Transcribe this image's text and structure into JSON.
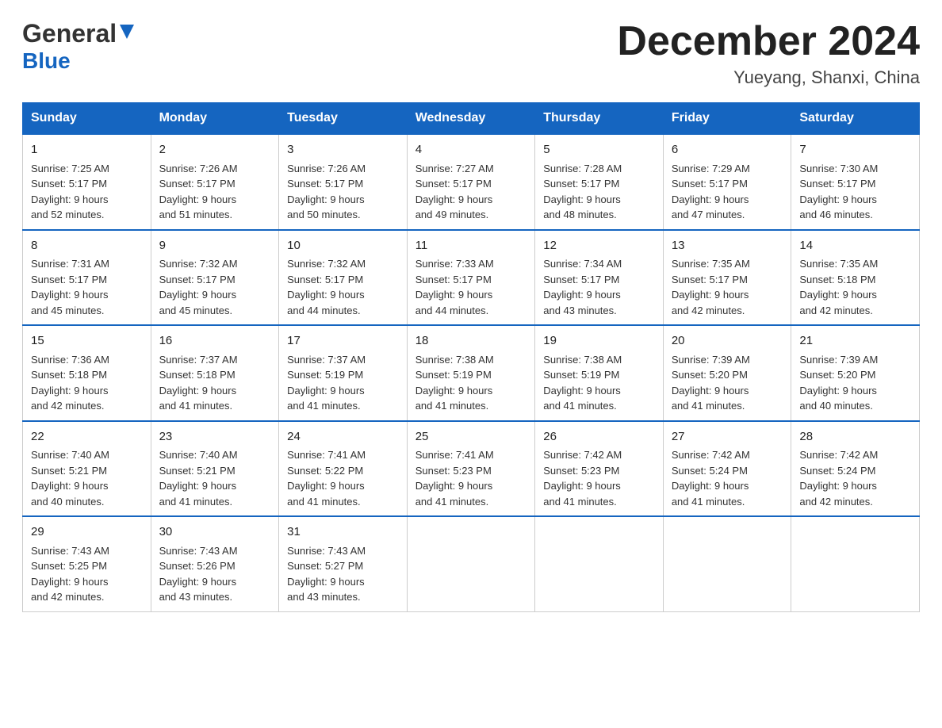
{
  "header": {
    "logo_line1": "General",
    "logo_line2": "Blue",
    "calendar_title": "December 2024",
    "calendar_subtitle": "Yueyang, Shanxi, China"
  },
  "weekdays": [
    "Sunday",
    "Monday",
    "Tuesday",
    "Wednesday",
    "Thursday",
    "Friday",
    "Saturday"
  ],
  "weeks": [
    [
      {
        "day": "1",
        "info": "Sunrise: 7:25 AM\nSunset: 5:17 PM\nDaylight: 9 hours\nand 52 minutes."
      },
      {
        "day": "2",
        "info": "Sunrise: 7:26 AM\nSunset: 5:17 PM\nDaylight: 9 hours\nand 51 minutes."
      },
      {
        "day": "3",
        "info": "Sunrise: 7:26 AM\nSunset: 5:17 PM\nDaylight: 9 hours\nand 50 minutes."
      },
      {
        "day": "4",
        "info": "Sunrise: 7:27 AM\nSunset: 5:17 PM\nDaylight: 9 hours\nand 49 minutes."
      },
      {
        "day": "5",
        "info": "Sunrise: 7:28 AM\nSunset: 5:17 PM\nDaylight: 9 hours\nand 48 minutes."
      },
      {
        "day": "6",
        "info": "Sunrise: 7:29 AM\nSunset: 5:17 PM\nDaylight: 9 hours\nand 47 minutes."
      },
      {
        "day": "7",
        "info": "Sunrise: 7:30 AM\nSunset: 5:17 PM\nDaylight: 9 hours\nand 46 minutes."
      }
    ],
    [
      {
        "day": "8",
        "info": "Sunrise: 7:31 AM\nSunset: 5:17 PM\nDaylight: 9 hours\nand 45 minutes."
      },
      {
        "day": "9",
        "info": "Sunrise: 7:32 AM\nSunset: 5:17 PM\nDaylight: 9 hours\nand 45 minutes."
      },
      {
        "day": "10",
        "info": "Sunrise: 7:32 AM\nSunset: 5:17 PM\nDaylight: 9 hours\nand 44 minutes."
      },
      {
        "day": "11",
        "info": "Sunrise: 7:33 AM\nSunset: 5:17 PM\nDaylight: 9 hours\nand 44 minutes."
      },
      {
        "day": "12",
        "info": "Sunrise: 7:34 AM\nSunset: 5:17 PM\nDaylight: 9 hours\nand 43 minutes."
      },
      {
        "day": "13",
        "info": "Sunrise: 7:35 AM\nSunset: 5:17 PM\nDaylight: 9 hours\nand 42 minutes."
      },
      {
        "day": "14",
        "info": "Sunrise: 7:35 AM\nSunset: 5:18 PM\nDaylight: 9 hours\nand 42 minutes."
      }
    ],
    [
      {
        "day": "15",
        "info": "Sunrise: 7:36 AM\nSunset: 5:18 PM\nDaylight: 9 hours\nand 42 minutes."
      },
      {
        "day": "16",
        "info": "Sunrise: 7:37 AM\nSunset: 5:18 PM\nDaylight: 9 hours\nand 41 minutes."
      },
      {
        "day": "17",
        "info": "Sunrise: 7:37 AM\nSunset: 5:19 PM\nDaylight: 9 hours\nand 41 minutes."
      },
      {
        "day": "18",
        "info": "Sunrise: 7:38 AM\nSunset: 5:19 PM\nDaylight: 9 hours\nand 41 minutes."
      },
      {
        "day": "19",
        "info": "Sunrise: 7:38 AM\nSunset: 5:19 PM\nDaylight: 9 hours\nand 41 minutes."
      },
      {
        "day": "20",
        "info": "Sunrise: 7:39 AM\nSunset: 5:20 PM\nDaylight: 9 hours\nand 41 minutes."
      },
      {
        "day": "21",
        "info": "Sunrise: 7:39 AM\nSunset: 5:20 PM\nDaylight: 9 hours\nand 40 minutes."
      }
    ],
    [
      {
        "day": "22",
        "info": "Sunrise: 7:40 AM\nSunset: 5:21 PM\nDaylight: 9 hours\nand 40 minutes."
      },
      {
        "day": "23",
        "info": "Sunrise: 7:40 AM\nSunset: 5:21 PM\nDaylight: 9 hours\nand 41 minutes."
      },
      {
        "day": "24",
        "info": "Sunrise: 7:41 AM\nSunset: 5:22 PM\nDaylight: 9 hours\nand 41 minutes."
      },
      {
        "day": "25",
        "info": "Sunrise: 7:41 AM\nSunset: 5:23 PM\nDaylight: 9 hours\nand 41 minutes."
      },
      {
        "day": "26",
        "info": "Sunrise: 7:42 AM\nSunset: 5:23 PM\nDaylight: 9 hours\nand 41 minutes."
      },
      {
        "day": "27",
        "info": "Sunrise: 7:42 AM\nSunset: 5:24 PM\nDaylight: 9 hours\nand 41 minutes."
      },
      {
        "day": "28",
        "info": "Sunrise: 7:42 AM\nSunset: 5:24 PM\nDaylight: 9 hours\nand 42 minutes."
      }
    ],
    [
      {
        "day": "29",
        "info": "Sunrise: 7:43 AM\nSunset: 5:25 PM\nDaylight: 9 hours\nand 42 minutes."
      },
      {
        "day": "30",
        "info": "Sunrise: 7:43 AM\nSunset: 5:26 PM\nDaylight: 9 hours\nand 43 minutes."
      },
      {
        "day": "31",
        "info": "Sunrise: 7:43 AM\nSunset: 5:27 PM\nDaylight: 9 hours\nand 43 minutes."
      },
      {
        "day": "",
        "info": ""
      },
      {
        "day": "",
        "info": ""
      },
      {
        "day": "",
        "info": ""
      },
      {
        "day": "",
        "info": ""
      }
    ]
  ]
}
